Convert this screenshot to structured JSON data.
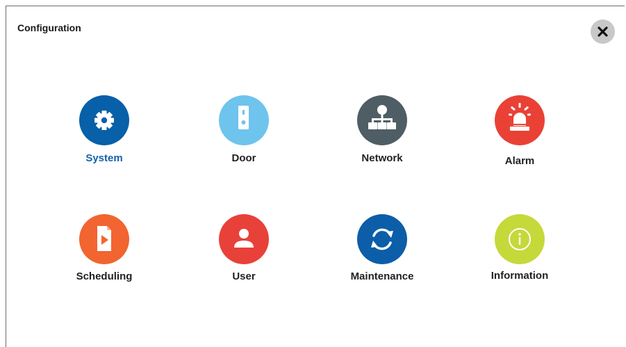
{
  "window": {
    "title": "Configuration",
    "close_icon": "close-icon"
  },
  "colors": {
    "system": "#0760a8",
    "door": "#6ec4ec",
    "network": "#4f5e64",
    "alarm": "#ea4136",
    "scheduling": "#f26430",
    "user": "#e8413a",
    "maintenance": "#0c5ea8",
    "information": "#c5d93a",
    "selected_label": "#1662a8"
  },
  "menu": {
    "selected": "System",
    "items": [
      {
        "label": "System",
        "icon": "gear-icon"
      },
      {
        "label": "Door",
        "icon": "door-station-icon"
      },
      {
        "label": "Network",
        "icon": "network-icon"
      },
      {
        "label": "Alarm",
        "icon": "alarm-siren-icon"
      },
      {
        "label": "Scheduling",
        "icon": "scheduled-video-file-icon"
      },
      {
        "label": "User",
        "icon": "user-icon"
      },
      {
        "label": "Maintenance",
        "icon": "refresh-icon"
      },
      {
        "label": "Information",
        "icon": "info-icon"
      }
    ]
  }
}
